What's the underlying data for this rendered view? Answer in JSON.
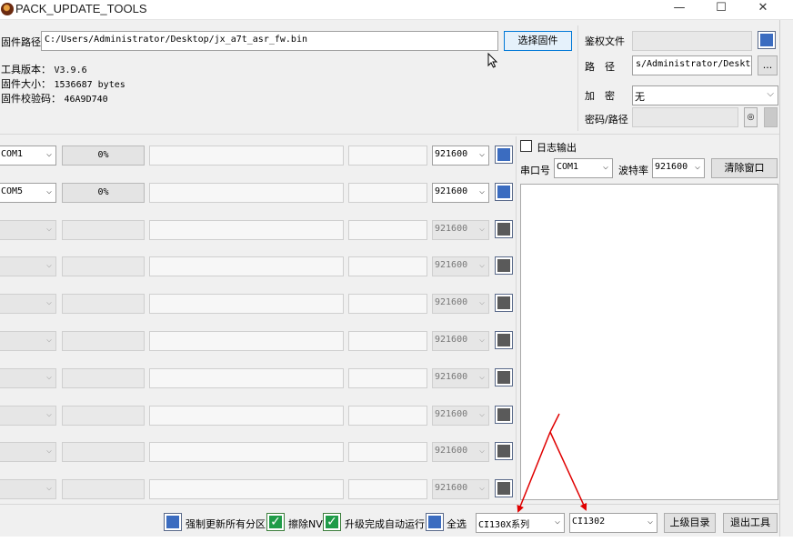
{
  "window": {
    "title": "PACK_UPDATE_TOOLS",
    "minimize_glyph": "—",
    "maximize_glyph": "☐",
    "close_glyph": "✕"
  },
  "firmware": {
    "path_label": "固件路径",
    "path_value": "C:/Users/Administrator/Desktop/jx_a7t_asr_fw.bin",
    "select_button": "选择固件",
    "tool_version_label": "工具版本：",
    "tool_version": "V3.9.6",
    "size_label": "固件大小：",
    "size": "1536687 bytes",
    "checksum_label": "固件校验码：",
    "checksum": "46A9D740"
  },
  "auth": {
    "auth_file_label": "鉴权文件",
    "path_label": "路　径",
    "path_value": "s/Administrator/Desktop",
    "browse_button": "...",
    "encrypt_label": "加　密",
    "encrypt_value": "无",
    "password_label": "密码/路径",
    "eye_glyph": "◎"
  },
  "ports": [
    {
      "port": "COM1",
      "progress": "0%",
      "baud": "921600",
      "enabled": true
    },
    {
      "port": "COM5",
      "progress": "0%",
      "baud": "921600",
      "enabled": true
    },
    {
      "port": "",
      "progress": "",
      "baud": "921600",
      "enabled": false
    },
    {
      "port": "",
      "progress": "",
      "baud": "921600",
      "enabled": false
    },
    {
      "port": "",
      "progress": "",
      "baud": "921600",
      "enabled": false
    },
    {
      "port": "",
      "progress": "",
      "baud": "921600",
      "enabled": false
    },
    {
      "port": "",
      "progress": "",
      "baud": "921600",
      "enabled": false
    },
    {
      "port": "",
      "progress": "",
      "baud": "921600",
      "enabled": false
    },
    {
      "port": "",
      "progress": "",
      "baud": "921600",
      "enabled": false
    },
    {
      "port": "",
      "progress": "",
      "baud": "921600",
      "enabled": false
    }
  ],
  "log": {
    "log_output_label": "日志输出",
    "port_label": "串口号",
    "port_value": "COM1",
    "baud_label": "波特率",
    "baud_value": "921600",
    "clear_button": "清除窗口"
  },
  "footer": {
    "force_update_label": "强制更新所有分区",
    "erase_nv_label": "擦除NV",
    "auto_run_label": "升级完成自动运行",
    "select_all_label": "全选",
    "chip_series": "CI130X系列",
    "chip_model": "CI1302",
    "parent_dir_button": "上级目录",
    "exit_button": "退出工具",
    "check_glyph": "✓"
  },
  "colors": {
    "blue_square": "#3b6cc0",
    "gray_square": "#5a5a5a",
    "green_check": "#1f9c48",
    "annotation_arrow": "#e00000"
  }
}
